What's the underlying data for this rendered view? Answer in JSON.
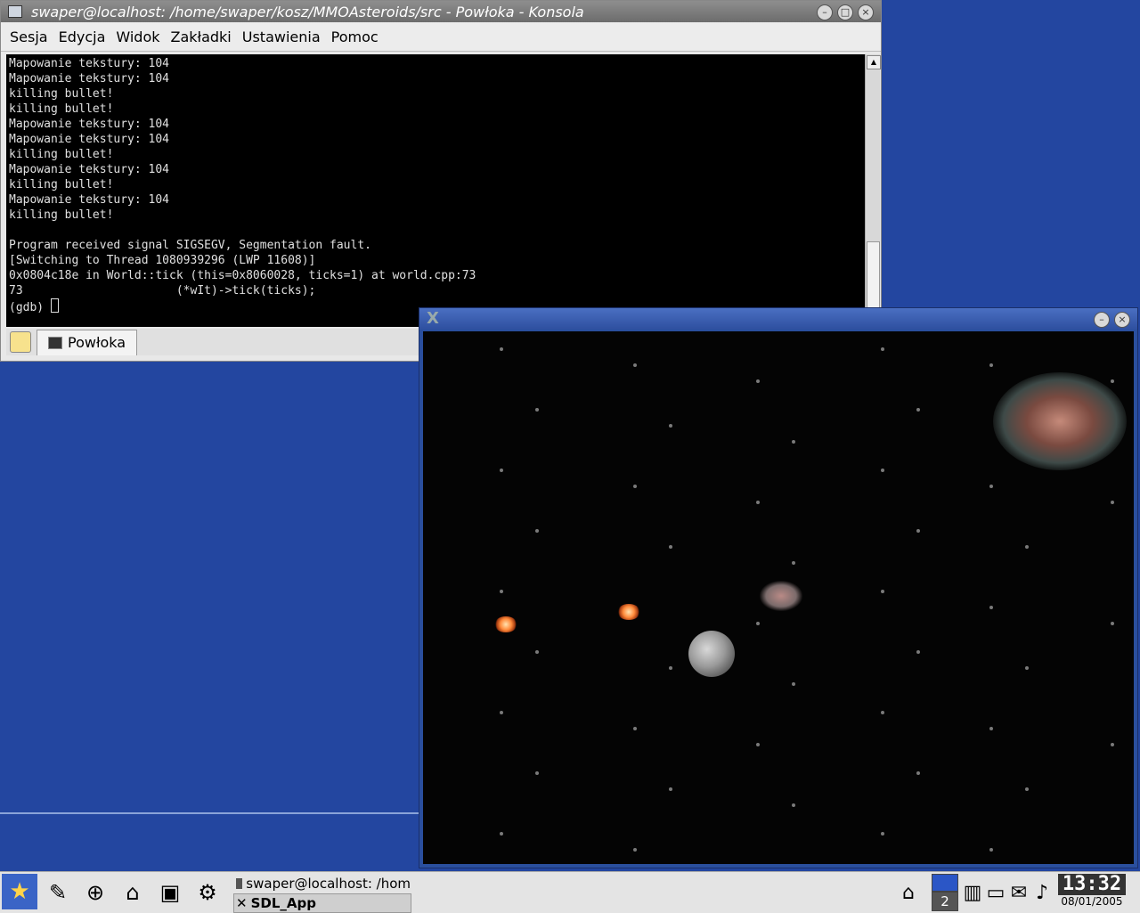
{
  "konsole": {
    "title": "swaper@localhost: /home/swaper/kosz/MMOAsteroids/src - Powłoka - Konsola",
    "menu": [
      "Sesja",
      "Edycja",
      "Widok",
      "Zakładki",
      "Ustawienia",
      "Pomoc"
    ],
    "terminal_lines": [
      "Mapowanie tekstury: 104",
      "Mapowanie tekstury: 104",
      "killing bullet!",
      "killing bullet!",
      "Mapowanie tekstury: 104",
      "Mapowanie tekstury: 104",
      "killing bullet!",
      "Mapowanie tekstury: 104",
      "killing bullet!",
      "Mapowanie tekstury: 104",
      "killing bullet!",
      "",
      "Program received signal SIGSEGV, Segmentation fault.",
      "[Switching to Thread 1080939296 (LWP 11608)]",
      "0x0804c18e in World::tick (this=0x8060028, ticks=1) at world.cpp:73",
      "73                      (*wIt)->tick(ticks);"
    ],
    "prompt": "(gdb) ",
    "tab_label": "Powłoka"
  },
  "sdl_window": {
    "title_icon": "X"
  },
  "taskbar": {
    "tasks": [
      {
        "label": "swaper@localhost: /hom"
      },
      {
        "label": "SDL_App"
      }
    ],
    "pager_number": "2",
    "clock_time": "13:32",
    "clock_date": "08/01/2005"
  },
  "icons": {
    "kmenu": "star-icon",
    "launchers": [
      "kwrite-icon",
      "browser-icon",
      "home-icon",
      "terminal-icon",
      "network-icon"
    ],
    "tray": [
      "home-icon",
      "monitor-icon",
      "display-icon",
      "notes-icon",
      "speaker-icon"
    ]
  }
}
